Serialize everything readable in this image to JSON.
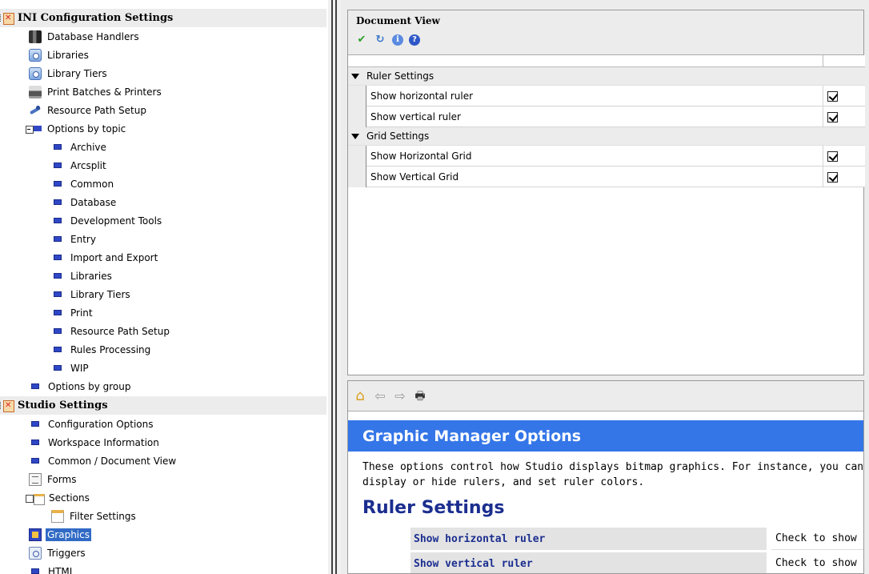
{
  "tree": {
    "sections": [
      {
        "label": "INI Configuration Settings"
      },
      {
        "label": "Studio Settings"
      }
    ],
    "ini_items": [
      {
        "label": "Database Handlers",
        "icon": "database-icon"
      },
      {
        "label": "Libraries",
        "icon": "library-icon"
      },
      {
        "label": "Library Tiers",
        "icon": "library-icon"
      },
      {
        "label": "Print Batches & Printers",
        "icon": "printer-icon"
      },
      {
        "label": "Resource Path Setup",
        "icon": "tools-icon"
      },
      {
        "label": "Options by topic",
        "icon": "folder-collapse-icon"
      }
    ],
    "topics": [
      "Archive",
      "Arcsplit",
      "Common",
      "Database",
      "Development Tools",
      "Entry",
      "Import and Export",
      "Libraries",
      "Library Tiers",
      "Print",
      "Resource Path Setup",
      "Rules Processing",
      "WIP"
    ],
    "options_by_group": "Options by group",
    "studio_items": [
      {
        "label": "Configuration Options"
      },
      {
        "label": "Workspace Information"
      },
      {
        "label": "Common / Document View"
      },
      {
        "label": "Forms"
      },
      {
        "label": "Sections"
      },
      {
        "label": "Filter Settings"
      },
      {
        "label": "Graphics"
      },
      {
        "label": "Triggers"
      },
      {
        "label": "HTML"
      }
    ],
    "selected": "Graphics"
  },
  "document_view": {
    "title": "Document View",
    "groups": [
      {
        "label": "Ruler Settings",
        "props": [
          {
            "name": "Show horizontal ruler",
            "checked": true
          },
          {
            "name": "Show vertical ruler",
            "checked": true
          }
        ]
      },
      {
        "label": "Grid Settings",
        "props": [
          {
            "name": "Show Horizontal Grid",
            "checked": true
          },
          {
            "name": "Show Vertical Grid",
            "checked": true
          }
        ]
      }
    ]
  },
  "help": {
    "title": "Graphic Manager Options",
    "desc_line1": "These options control how Studio displays bitmap graphics. For instance, you can",
    "desc_line2": "display or hide rulers, and set ruler colors.",
    "heading": "Ruler Settings",
    "rows": [
      {
        "key": "Show horizontal ruler",
        "value": "Check to show"
      },
      {
        "key": "Show vertical ruler",
        "value": "Check to show"
      }
    ]
  },
  "colors": {
    "banner": "#3476e8",
    "selection": "#316ac5",
    "help_heading": "#1b2e8f"
  }
}
